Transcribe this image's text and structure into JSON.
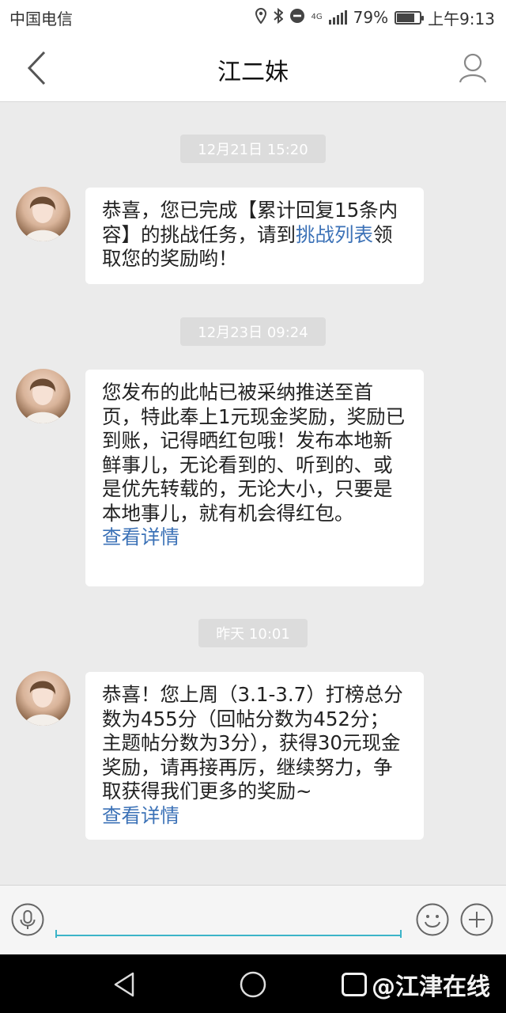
{
  "status_bar": {
    "carrier": "中国电信",
    "network": "4G",
    "battery": "79%",
    "battery_level": 0.79,
    "time": "上午9:13"
  },
  "header": {
    "title": "江二妹"
  },
  "messages": [
    {
      "timestamp": "12月21日 15:20",
      "text": "恭喜，您已完成【累计回复15条内容】的挑战任务，请到",
      "link_text": "挑战列表",
      "text_after": "领取您的奖励哟！"
    },
    {
      "timestamp": "12月23日 09:24",
      "text": "您发布的此帖已被采纳推送至首页，特此奉上1元现金奖励，奖励已到账，记得晒红包哦！发布本地新鲜事儿，无论看到的、听到的、或是优先转载的，无论大小，只要是本地事儿，就有机会得红包。",
      "link_text": "查看详情"
    },
    {
      "timestamp": "昨天 10:01",
      "text": "恭喜！您上周（3.1-3.7）打榜总分数为455分（回帖分数为452分；主题帖分数为3分），获得30元现金奖励，请再接再厉，继续努力，争取获得我们更多的奖励~",
      "link_text": "查看详情"
    }
  ],
  "input": {
    "placeholder": ""
  },
  "watermark": "@江津在线",
  "icons": {
    "back": "chevron-left-icon",
    "profile": "user-icon",
    "voice": "microphone-icon",
    "emoji": "smiley-icon",
    "plus": "plus-icon"
  }
}
